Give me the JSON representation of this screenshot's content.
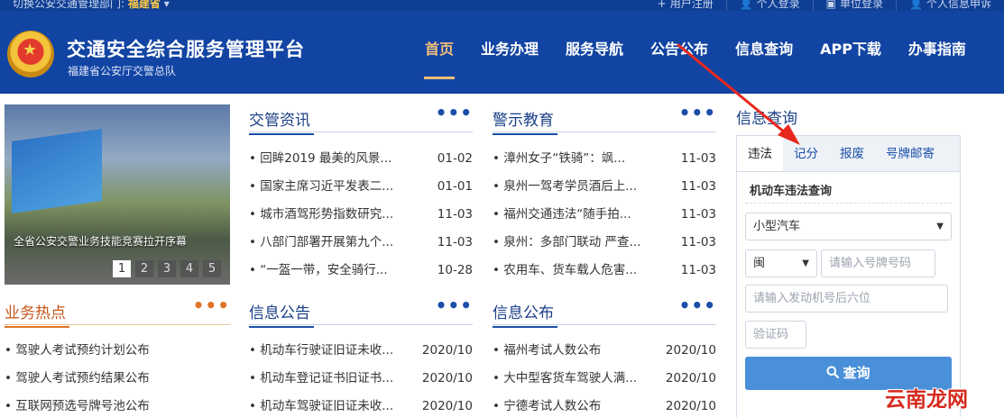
{
  "topbar": {
    "switch_label": "切换公安交通管理部门:",
    "province": "福建省",
    "links": [
      "用户注册",
      "个人登录",
      "单位登录",
      "个人信息申诉"
    ]
  },
  "header": {
    "title": "交通安全综合服务管理平台",
    "subtitle": "福建省公安厅交警总队",
    "nav": [
      "首页",
      "业务办理",
      "服务导航",
      "公告公布",
      "信息查询",
      "APP下载",
      "办事指南"
    ],
    "active_nav": 0
  },
  "carousel": {
    "caption": "全省公安交警业务技能竞赛拉开序幕",
    "pages": [
      "1",
      "2",
      "3",
      "4",
      "5"
    ],
    "active_page": 0
  },
  "sections": {
    "jiaoguan": {
      "title": "交管资讯",
      "items": [
        {
          "text": "• 回眸2019 最美的风景...",
          "date": "01-02"
        },
        {
          "text": "• 国家主席习近平发表二...",
          "date": "01-01"
        },
        {
          "text": "• 城市酒驾形势指数研究...",
          "date": "11-03"
        },
        {
          "text": "• 八部门部署开展第九个...",
          "date": "11-03"
        },
        {
          "text": "• “一盔一带，安全骑行...",
          "date": "10-28"
        }
      ]
    },
    "jingshi": {
      "title": "警示教育",
      "items": [
        {
          "text": "• 漳州女子“铁骑”：飒...",
          "date": "11-03"
        },
        {
          "text": "• 泉州一驾考学员酒后上...",
          "date": "11-03"
        },
        {
          "text": "• 福州交通违法“随手拍...",
          "date": "11-03"
        },
        {
          "text": "• 泉州：多部门联动 严查...",
          "date": "11-03"
        },
        {
          "text": "• 农用车、货车载人危害...",
          "date": "11-03"
        }
      ]
    },
    "redian": {
      "title": "业务热点",
      "items": [
        {
          "text": "• 驾驶人考试预约计划公布"
        },
        {
          "text": "• 驾驶人考试预约结果公布"
        },
        {
          "text": "• 互联网预选号牌号池公布"
        }
      ]
    },
    "gonggao": {
      "title": "信息公告",
      "items": [
        {
          "text": "• 机动车行驶证旧证未收...",
          "date": "2020/10"
        },
        {
          "text": "• 机动车登记证书旧证书...",
          "date": "2020/10"
        },
        {
          "text": "• 机动车驾驶证旧证未收...",
          "date": "2020/10"
        }
      ]
    },
    "gongbu": {
      "title": "信息公布",
      "items": [
        {
          "text": "• 福州考试人数公布",
          "date": "2020/10"
        },
        {
          "text": "• 大中型客货车驾驶人满...",
          "date": "2020/10"
        },
        {
          "text": "• 宁德考试人数公布",
          "date": "2020/10"
        }
      ]
    },
    "more_label": "•••"
  },
  "query": {
    "title": "信息查询",
    "tabs": [
      "违法",
      "记分",
      "报废",
      "号牌邮寄"
    ],
    "active_tab": 0,
    "subtitle": "机动车违法查询",
    "vehicle_type": "小型汽车",
    "plate_prefix": "闽",
    "plate_placeholder": "请输入号牌号码",
    "engine_placeholder": "请输入发动机号后六位",
    "captcha_placeholder": "验证码",
    "submit_label": "查询"
  },
  "watermark": "云南龙网",
  "colors": {
    "header_bg": "#1244a3",
    "topbar_bg": "#0f3f94",
    "nav_active": "#f3c07a",
    "section_blue": "#1a4ea8",
    "section_orange": "#e07426",
    "button_blue": "#4a90d9",
    "arrow_red": "#e8281f"
  },
  "icons": {
    "register": "user-plus-icon",
    "person_login": "user-icon",
    "unit_login": "building-icon",
    "appeal": "user-edit-icon",
    "dropdown": "caret-down-icon",
    "search": "search-icon"
  }
}
